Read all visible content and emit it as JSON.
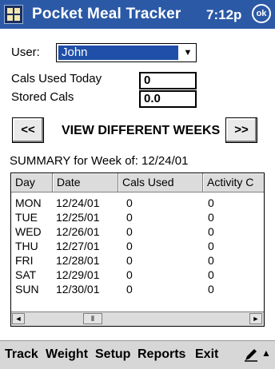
{
  "titlebar": {
    "title": "Pocket Meal Tracker",
    "time": "7:12p",
    "ok_label": "ok",
    "start_icon": "windows-flag-icon",
    "accent": "#2b59a6"
  },
  "form": {
    "user_label": "User:",
    "user_value": "John",
    "cals_used_label": "Cals Used Today",
    "cals_used_value": "0",
    "stored_cals_label": "Stored Cals",
    "stored_cals_value": "0.0"
  },
  "week_nav": {
    "prev_label": "<<",
    "caption": "VIEW DIFFERENT WEEKS",
    "next_label": ">>"
  },
  "summary": {
    "label": "SUMMARY for Week of: 12/24/01"
  },
  "grid": {
    "columns": [
      "Day",
      "Date",
      "Cals Used",
      "Activity C"
    ],
    "rows": [
      [
        "MON",
        "12/24/01",
        "0",
        "0"
      ],
      [
        "TUE",
        "12/25/01",
        "0",
        "0"
      ],
      [
        "WED",
        "12/26/01",
        "0",
        "0"
      ],
      [
        "THU",
        "12/27/01",
        "0",
        "0"
      ],
      [
        "FRI",
        "12/28/01",
        "0",
        "0"
      ],
      [
        "SAT",
        "12/29/01",
        "0",
        "0"
      ],
      [
        "SUN",
        "12/30/01",
        "0",
        "0"
      ]
    ],
    "scroll_left": "◄",
    "scroll_right": "►",
    "scroll_thumb": "⦀"
  },
  "menubar": {
    "items": [
      "Track",
      "Weight",
      "Setup",
      "Reports",
      "Exit"
    ],
    "input_icon": "pen-icon",
    "sip_arrow": "▲"
  }
}
